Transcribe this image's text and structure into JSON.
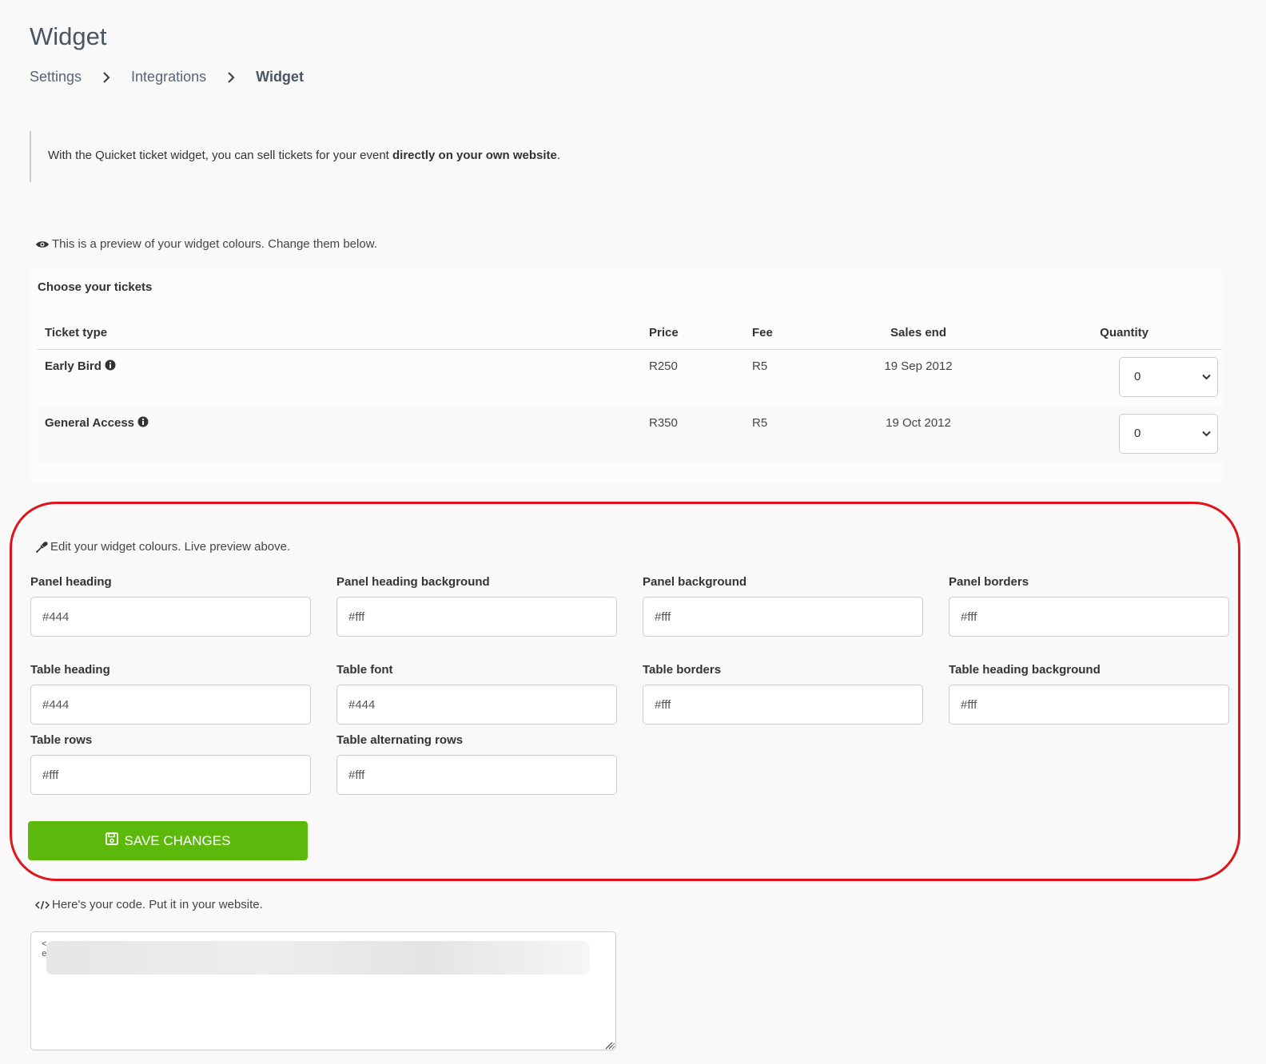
{
  "page": {
    "title": "Widget"
  },
  "breadcrumb": {
    "items": [
      "Settings",
      "Integrations",
      "Widget"
    ]
  },
  "intro": {
    "text_before": "With the Quicket ticket widget, you can sell tickets for your event ",
    "text_bold": "directly on your own website",
    "text_after": "."
  },
  "preview": {
    "hint": "This is a preview of your widget colours. Change them below.",
    "panel_heading": "Choose your tickets",
    "columns": [
      "Ticket type",
      "Price",
      "Fee",
      "Sales end",
      "Quantity"
    ],
    "rows": [
      {
        "ticket": "Early Bird",
        "price": "R250",
        "fee": "R5",
        "sales_end": "19 Sep 2012",
        "quantity": "0"
      },
      {
        "ticket": "General Access",
        "price": "R350",
        "fee": "R5",
        "sales_end": "19 Oct 2012",
        "quantity": "0"
      }
    ]
  },
  "edit": {
    "hint": "Edit your widget colours. Live preview above.",
    "fields": {
      "panel_heading": {
        "label": "Panel heading",
        "value": "#444"
      },
      "panel_heading_background": {
        "label": "Panel heading background",
        "value": "#fff"
      },
      "panel_background": {
        "label": "Panel background",
        "value": "#fff"
      },
      "panel_borders": {
        "label": "Panel borders",
        "value": "#fff"
      },
      "table_heading": {
        "label": "Table heading",
        "value": "#444"
      },
      "table_font": {
        "label": "Table font",
        "value": "#444"
      },
      "table_borders": {
        "label": "Table borders",
        "value": "#fff"
      },
      "table_heading_background": {
        "label": "Table heading background",
        "value": "#fff"
      },
      "table_rows": {
        "label": "Table rows",
        "value": "#fff"
      },
      "table_alternating_rows": {
        "label": "Table alternating rows",
        "value": "#fff"
      }
    },
    "save_label": "SAVE CHANGES"
  },
  "code": {
    "hint": "Here's your code. Put it in your website.",
    "visible_chars": "<\ne"
  },
  "colors": {
    "accent_green": "#5cb80a",
    "highlight_red": "#e0141b",
    "title": "#4a5563"
  }
}
